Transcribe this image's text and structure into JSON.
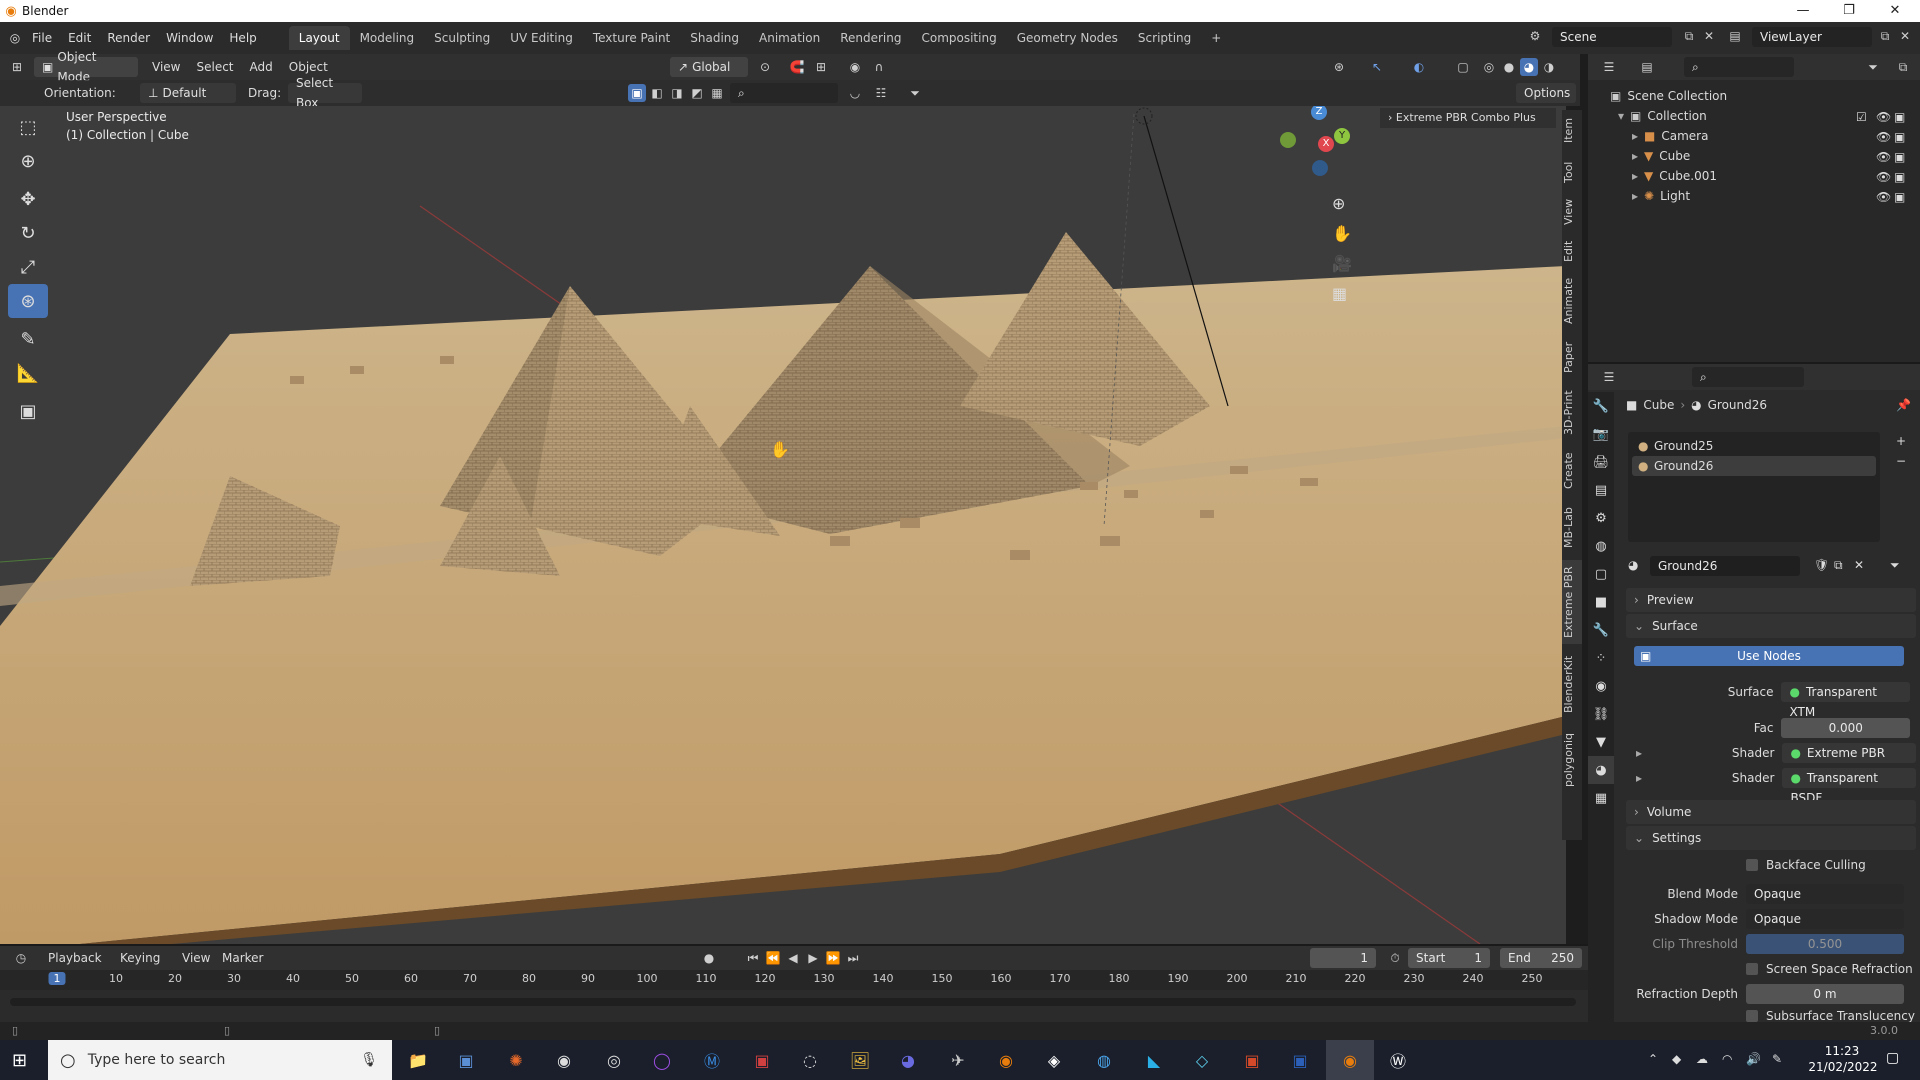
{
  "window": {
    "title": "Blender",
    "min": "—",
    "max": "❐",
    "close": "✕"
  },
  "menu": [
    "File",
    "Edit",
    "Render",
    "Window",
    "Help"
  ],
  "workspaces": [
    "Layout",
    "Modeling",
    "Sculpting",
    "UV Editing",
    "Texture Paint",
    "Shading",
    "Animation",
    "Rendering",
    "Compositing",
    "Geometry Nodes",
    "Scripting"
  ],
  "workspace_add": "+",
  "scene": {
    "label": "Scene",
    "viewlayer": "ViewLayer"
  },
  "viewport_header": {
    "mode": "Object Mode",
    "menus": [
      "View",
      "Select",
      "Add",
      "Object"
    ],
    "transform": "Global"
  },
  "tool_settings": {
    "orientation_label": "Orientation:",
    "orientation_value": "Default",
    "drag_label": "Drag:",
    "drag_value": "Select Box",
    "options": "Options"
  },
  "viewport": {
    "perspective": "User Perspective",
    "collection": "(1) Collection | Cube",
    "panel": "Extreme PBR Combo Plus",
    "gizmo": {
      "z": "Z",
      "y": "Y",
      "x": "X"
    }
  },
  "side_tabs": [
    "Item",
    "Tool",
    "View",
    "Edit",
    "Animate",
    "Paper",
    "3D-Print",
    "Create",
    "MB-Lab",
    "Extreme PBR",
    "BlenderKit",
    "polygoniq"
  ],
  "outliner": {
    "root": "Scene Collection",
    "collection": "Collection",
    "items": [
      "Camera",
      "Cube",
      "Cube.001",
      "Light"
    ]
  },
  "properties": {
    "breadcrumb_object": "Cube",
    "breadcrumb_material": "Ground26",
    "slots": [
      "Ground25",
      "Ground26"
    ],
    "material_name": "Ground26",
    "sections": {
      "preview": "Preview",
      "surface": "Surface",
      "volume": "Volume",
      "settings": "Settings"
    },
    "use_nodes": "Use Nodes",
    "surface_label": "Surface",
    "surface_value": "Transparent XTM",
    "fac_label": "Fac",
    "fac_value": "0.000",
    "shader_label": "Shader",
    "shader1": "Extreme PBR BSDF",
    "shader2": "Transparent BSDF",
    "backface": "Backface Culling",
    "blend_label": "Blend Mode",
    "blend_value": "Opaque",
    "shadow_label": "Shadow Mode",
    "shadow_value": "Opaque",
    "clip_label": "Clip Threshold",
    "clip_value": "0.500",
    "ssr": "Screen Space Refraction",
    "refraction_label": "Refraction Depth",
    "refraction_value": "0 m",
    "subsurface": "Subsurface Translucency"
  },
  "timeline": {
    "menus": [
      "Playback",
      "Keying",
      "View",
      "Marker"
    ],
    "current_frame": "1",
    "start_label": "Start",
    "start": "1",
    "end_label": "End",
    "end": "250",
    "ticks": [
      "1",
      "10",
      "20",
      "30",
      "40",
      "50",
      "60",
      "70",
      "80",
      "90",
      "100",
      "110",
      "120",
      "130",
      "140",
      "150",
      "160",
      "170",
      "180",
      "190",
      "200",
      "210",
      "220",
      "230",
      "240",
      "250"
    ]
  },
  "status": {
    "version": "3.0.0"
  },
  "taskbar": {
    "search_placeholder": "Type here to search",
    "time": "11:23",
    "date": "21/02/2022"
  },
  "colors": {
    "accent": "#4772b3",
    "sand": "#c8a97c",
    "brand": "#e87d0d"
  }
}
